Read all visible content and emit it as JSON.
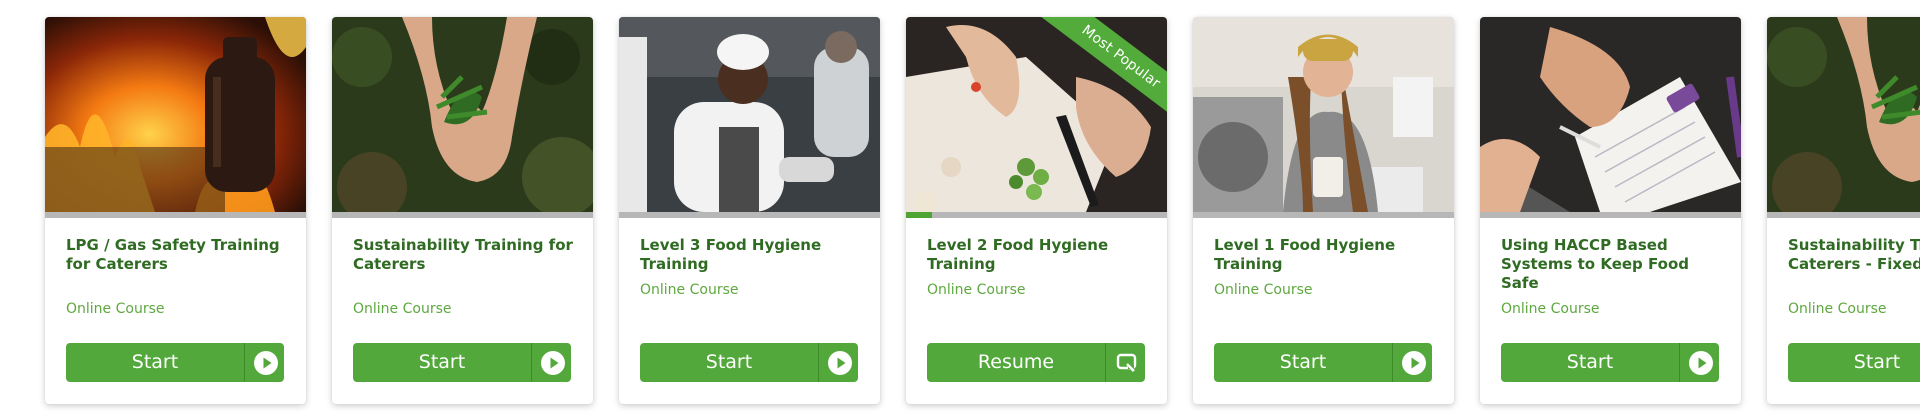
{
  "courses": [
    {
      "title": "LPG / Gas Safety Training for Caterers",
      "type": "Online Course",
      "button": "Start",
      "button_icon": "play-icon"
    },
    {
      "title": "Sustainability Training for Caterers",
      "type": "Online Course",
      "button": "Start",
      "button_icon": "play-icon"
    },
    {
      "title": "Level 3 Food Hygiene Training",
      "type": "Online Course",
      "button": "Start",
      "button_icon": "play-icon"
    },
    {
      "title": "Level 2 Food Hygiene Training",
      "type": "Online Course",
      "button": "Resume",
      "button_icon": "replay-icon",
      "badge": "Most Popular",
      "progress_percent": 10
    },
    {
      "title": "Level 1 Food Hygiene Training",
      "type": "Online Course",
      "button": "Start",
      "button_icon": "play-icon"
    },
    {
      "title": "Using HACCP Based Systems to Keep Food Safe",
      "type": "Online Course",
      "button": "Start",
      "button_icon": "play-icon"
    },
    {
      "title": "Sustainability Training for Caterers - Fixed Site",
      "type": "Online Course",
      "button": "Start",
      "button_icon": "play-icon"
    }
  ],
  "colors": {
    "accent": "#52a83a",
    "title": "#2f6b22",
    "subtitle": "#5ea83f",
    "track": "#b7b7b7"
  }
}
